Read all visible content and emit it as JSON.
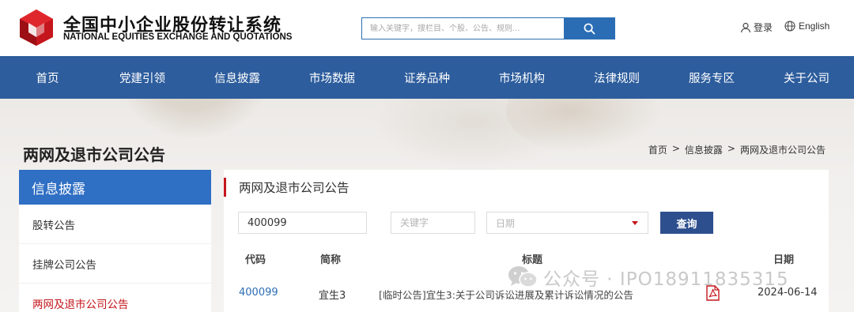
{
  "header": {
    "brand_cn": "全国中小企业股份转让系统",
    "brand_en": "NATIONAL EQUITIES EXCHANGE AND QUOTATIONS",
    "search_placeholder": "输入关键字，搜栏目、个股、公告、规则...",
    "login_label": "登录",
    "lang_label": "English"
  },
  "nav": {
    "items": [
      "首页",
      "党建引领",
      "信息披露",
      "市场数据",
      "证券品种",
      "市场机构",
      "法律规则",
      "服务专区",
      "关于公司"
    ]
  },
  "page": {
    "title": "两网及退市公司公告",
    "breadcrumb": [
      "首页",
      "信息披露",
      "两网及退市公司公告"
    ],
    "breadcrumb_sep": ">"
  },
  "sidebar": {
    "heading": "信息披露",
    "items": [
      {
        "label": "股转公告"
      },
      {
        "label": "挂牌公司公告"
      },
      {
        "label": "两网及退市公司公告"
      }
    ]
  },
  "main": {
    "title": "两网及退市公司公告",
    "filters": {
      "code_value": "400099",
      "keyword_placeholder": "关键字",
      "date_placeholder": "日期",
      "query_label": "查询"
    },
    "columns": [
      "代码",
      "简称",
      "标题",
      "日期"
    ],
    "rows": [
      {
        "code": "400099",
        "name": "宜生3",
        "title": "[临时公告]宜生3:关于公司诉讼进展及累计诉讼情况的公告",
        "date": "2024-06-14"
      }
    ]
  },
  "watermark": {
    "text": "公众号 · IPO18911835315"
  },
  "colors": {
    "nav_bg": "#2d5d9d",
    "sidebar_head_bg": "#2f6fc4",
    "accent_red": "#c4161c",
    "query_btn": "#2d4f8e",
    "link_blue": "#2a6db5"
  }
}
